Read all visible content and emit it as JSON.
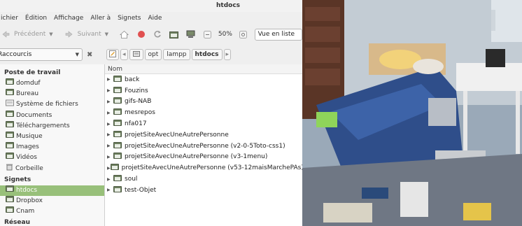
{
  "window": {
    "title": "htdocs",
    "menu": [
      "ichier",
      "Édition",
      "Affichage",
      "Aller à",
      "Signets",
      "Aide"
    ],
    "toolbar": {
      "back_label": "Précédent",
      "forward_label": "Suivant",
      "zoom": "50%",
      "view_mode": "Vue en liste"
    },
    "sidebar": {
      "places_label": "Raccourcis",
      "sections": [
        {
          "heading": "Poste de travail",
          "items": [
            "domduf",
            "Bureau",
            "Système de fichiers",
            "Documents",
            "Téléchargements",
            "Musique",
            "Images",
            "Vidéos",
            "Corbeille"
          ]
        },
        {
          "heading": "Signets",
          "items": [
            "htdocs",
            "Dropbox",
            "Cnam"
          ]
        },
        {
          "heading": "Réseau",
          "items": []
        }
      ],
      "selected": "htdocs"
    },
    "path": [
      "opt",
      "lampp",
      "htdocs"
    ],
    "files": {
      "column_header": "Nom",
      "rows": [
        "back",
        "Fouzins",
        "gifs-NAB",
        "mesrepos",
        "nfa017",
        "projetSiteAvecUneAutrePersonne",
        "projetSiteAvecUneAutrePersonne (v2-0-5Toto-css1)",
        "projetSiteAvecUneAutrePersonne (v3-1menu)",
        "projetSiteAvecUneAutrePersonne (v53-12maisMarchePAs)",
        "soul",
        "test-Objet"
      ]
    }
  },
  "colors": {
    "selection": "#98c07a",
    "window_bg": "#efefef",
    "folder": "#6d7f5e"
  },
  "icons": {
    "back": "arrow-left-icon",
    "forward": "arrow-right-icon",
    "home": "home-icon",
    "stop": "stop-icon",
    "reload": "reload-icon",
    "computer": "computer-icon",
    "trash": "trash-icon",
    "folder": "folder-icon",
    "filesystem": "drive-icon",
    "edit": "edit-path-icon"
  }
}
